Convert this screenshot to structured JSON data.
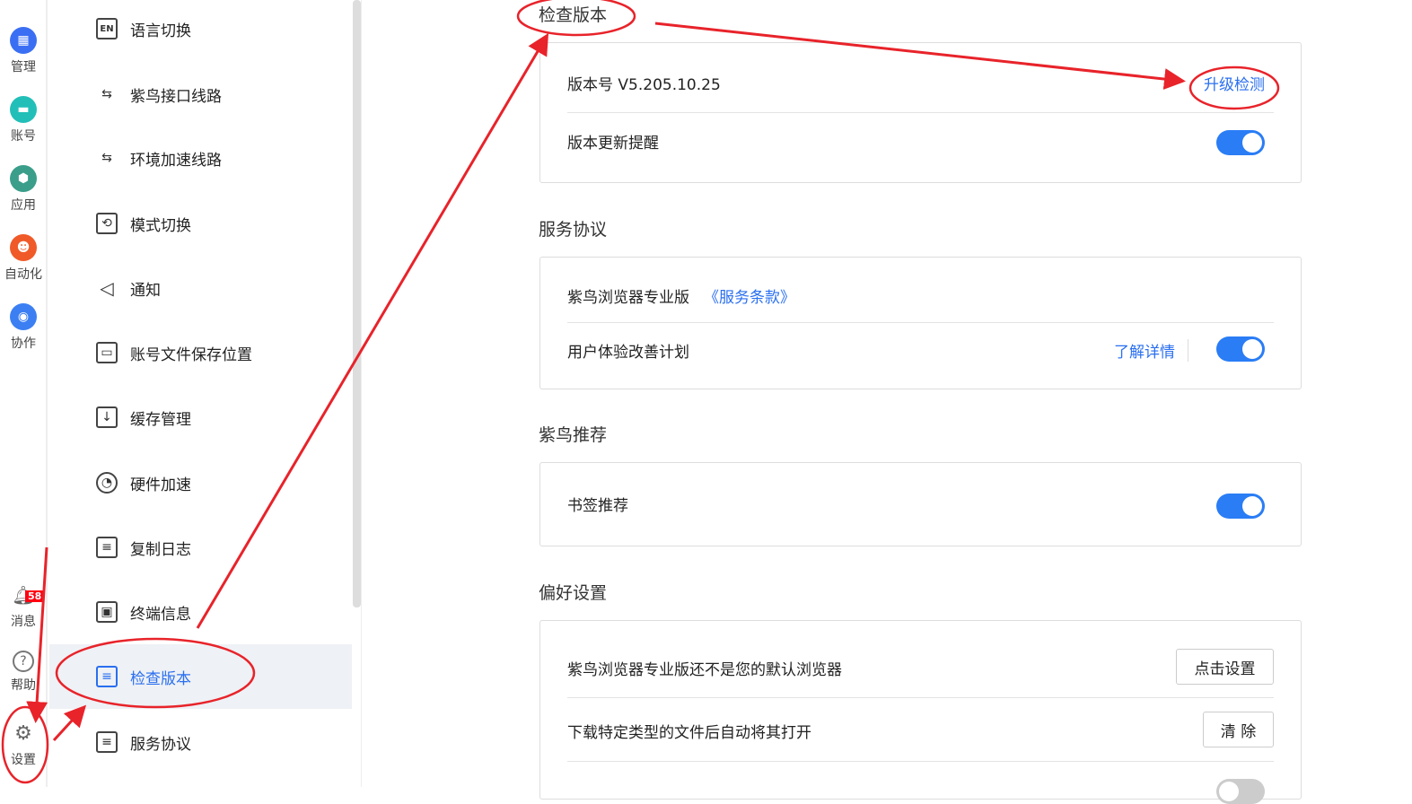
{
  "rail": [
    {
      "label": "管理",
      "color": "#3b6ff3"
    },
    {
      "label": "账号",
      "color": "#22bfb8"
    },
    {
      "label": "应用",
      "color": "#3a9e8a"
    },
    {
      "label": "自动化",
      "color": "#f05a28"
    },
    {
      "label": "协作",
      "color": "#3b7ff3"
    }
  ],
  "rail_bottom": {
    "messages": "消息",
    "messages_badge": "58",
    "help": "帮助",
    "settings": "设置"
  },
  "menu": [
    {
      "label": "语言切换",
      "icon": "EN"
    },
    {
      "label": "紫鸟接口线路",
      "icon": "⇆"
    },
    {
      "label": "环境加速线路",
      "icon": "⇆"
    },
    {
      "label": "模式切换",
      "icon": "⟲"
    },
    {
      "label": "通知",
      "icon": "◁"
    },
    {
      "label": "账号文件保存位置",
      "icon": "▭"
    },
    {
      "label": "缓存管理",
      "icon": "↓"
    },
    {
      "label": "硬件加速",
      "icon": "◔"
    },
    {
      "label": "复制日志",
      "icon": "≡"
    },
    {
      "label": "终端信息",
      "icon": "▣"
    },
    {
      "label": "检查版本",
      "icon": "≡"
    },
    {
      "label": "服务协议",
      "icon": "≡"
    }
  ],
  "sections": {
    "version": {
      "title": "检查版本",
      "version": "版本号 V5.205.10.25",
      "upgrade": "升级检测",
      "reminder": "版本更新提醒",
      "reminder_on": true
    },
    "agreement": {
      "title": "服务协议",
      "product": "紫鸟浏览器专业版",
      "terms": "《服务条款》",
      "ux": "用户体验改善计划",
      "details": "了解详情",
      "ux_on": true
    },
    "recommend": {
      "title": "紫鸟推荐",
      "bookmark": "书签推荐",
      "bookmark_on": true
    },
    "prefs": {
      "title": "偏好设置",
      "default_browser": "紫鸟浏览器专业版还不是您的默认浏览器",
      "set_btn": "点击设置",
      "auto_open": "下载特定类型的文件后自动将其打开",
      "clear_btn": "清 除"
    }
  }
}
